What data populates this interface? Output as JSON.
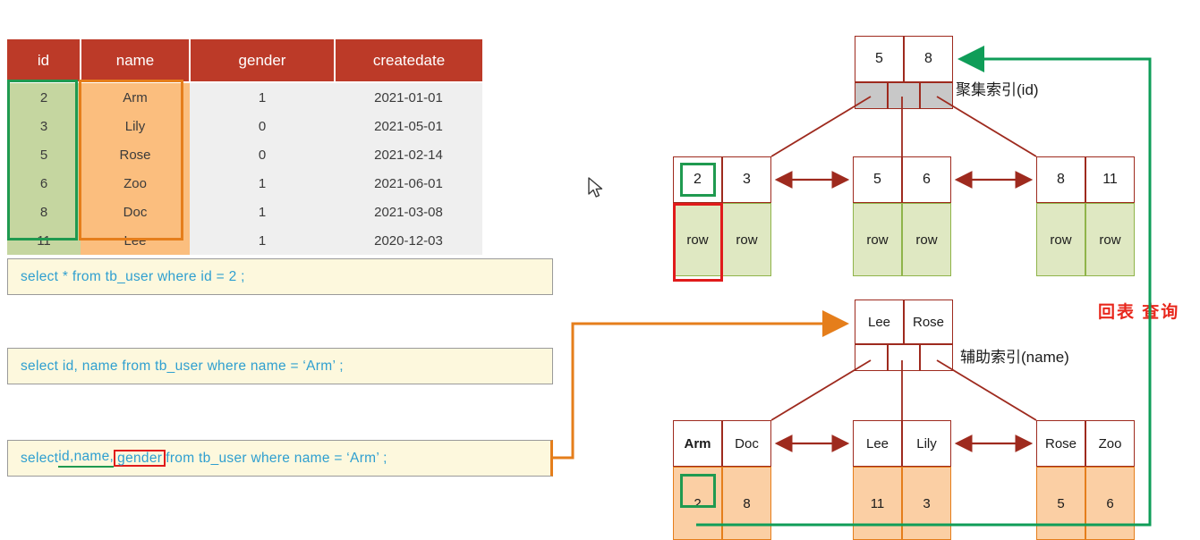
{
  "table": {
    "columns": [
      "id",
      "name",
      "gender",
      "createdate"
    ],
    "rows": [
      {
        "id": "2",
        "name": "Arm",
        "gender": "1",
        "createdate": "2021-01-01"
      },
      {
        "id": "3",
        "name": "Lily",
        "gender": "0",
        "createdate": "2021-05-01"
      },
      {
        "id": "5",
        "name": "Rose",
        "gender": "0",
        "createdate": "2021-02-14"
      },
      {
        "id": "6",
        "name": "Zoo",
        "gender": "1",
        "createdate": "2021-06-01"
      },
      {
        "id": "8",
        "name": "Doc",
        "gender": "1",
        "createdate": "2021-03-08"
      },
      {
        "id": "11",
        "name": "Lee",
        "gender": "1",
        "createdate": "2020-12-03"
      }
    ],
    "header_color": "#bc3a28",
    "id_highlight_color": "#1f9a50",
    "name_highlight_color": "#e57e1b"
  },
  "sql": {
    "q1": "select * from  tb_user  where  id  =  2 ;",
    "q2": "select  id, name  from  tb_user  where  name = ‘Arm’ ;",
    "q3": {
      "prefix": "select ",
      "underlined": "id,name,",
      "boxed": "gender",
      "suffix": " from  tb_user  where  name = ‘Arm’ ;"
    }
  },
  "clustered_index": {
    "label": "聚集索引(id)",
    "root_keys": [
      "5",
      "8"
    ],
    "leaves": [
      {
        "keys": [
          "2",
          "3"
        ],
        "data": [
          "row",
          "row"
        ]
      },
      {
        "keys": [
          "5",
          "6"
        ],
        "data": [
          "row",
          "row"
        ]
      },
      {
        "keys": [
          "8",
          "11"
        ],
        "data": [
          "row",
          "row"
        ]
      }
    ]
  },
  "secondary_index": {
    "label": "辅助索引(name)",
    "root_keys": [
      "Lee",
      "Rose"
    ],
    "leaves": [
      {
        "keys": [
          "Arm",
          "Doc"
        ],
        "data": [
          "2",
          "8"
        ]
      },
      {
        "keys": [
          "Lee",
          "Lily"
        ],
        "data": [
          "11",
          "3"
        ]
      },
      {
        "keys": [
          "Rose",
          "Zoo"
        ],
        "data": [
          "5",
          "6"
        ]
      }
    ]
  },
  "annotations": {
    "lookup_label": "回表 查询",
    "lookup_color": "#e8271c",
    "return_line_color": "#0f9d58",
    "connector_color": "#e57e1b",
    "tree_line_color": "#9e2a1e"
  },
  "icons": {
    "cursor": "mouse-cursor"
  }
}
